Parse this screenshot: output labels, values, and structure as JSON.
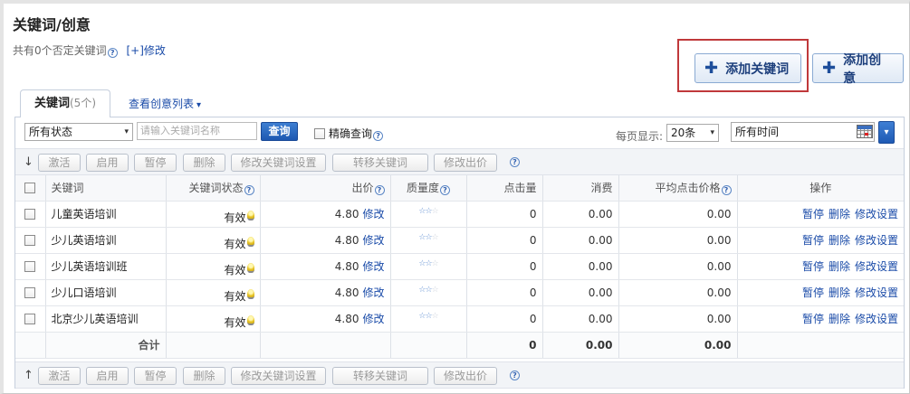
{
  "page": {
    "title": "关键词/创意",
    "negative_text": "共有0个否定关键词",
    "modify_link": "[+]修改"
  },
  "buttons": {
    "add_keyword": "添加关键词",
    "add_creative": "添加创意",
    "plus": "✚"
  },
  "tabs": {
    "active_label": "关键词",
    "active_count": "(5个)",
    "creative_link": "查看创意列表",
    "creative_arrow": "▾"
  },
  "filters": {
    "status_value": "所有状态",
    "search_placeholder": "请输入关键词名称",
    "search_button": "查询",
    "exact_label": "精确查询",
    "per_page_label": "每页显示:",
    "per_page_value": "20条",
    "time_value": "所有时间",
    "caret": "▾"
  },
  "actions": {
    "sort_top": "↓",
    "sort_bottom": "↑",
    "labels": [
      "激活",
      "启用",
      "暂停",
      "删除",
      "修改关键词设置",
      "转移关键词",
      "修改出价"
    ]
  },
  "table": {
    "headers": {
      "keyword": "关键词",
      "status": "关键词状态",
      "bid": "出价",
      "quality": "质量度",
      "clicks": "点击量",
      "spend": "消费",
      "avg_cpc": "平均点击价格",
      "ops": "操作"
    },
    "rows": [
      {
        "keyword": "儿童英语培训",
        "status": "有效",
        "bid": "4.80",
        "edit": "修改",
        "stars": 2,
        "clicks": "0",
        "spend": "0.00",
        "avg_cpc": "0.00"
      },
      {
        "keyword": "少儿英语培训",
        "status": "有效",
        "bid": "4.80",
        "edit": "修改",
        "stars": 2,
        "clicks": "0",
        "spend": "0.00",
        "avg_cpc": "0.00"
      },
      {
        "keyword": "少儿英语培训班",
        "status": "有效",
        "bid": "4.80",
        "edit": "修改",
        "stars": 2,
        "clicks": "0",
        "spend": "0.00",
        "avg_cpc": "0.00"
      },
      {
        "keyword": "少儿口语培训",
        "status": "有效",
        "bid": "4.80",
        "edit": "修改",
        "stars": 2,
        "clicks": "0",
        "spend": "0.00",
        "avg_cpc": "0.00"
      },
      {
        "keyword": "北京少儿英语培训",
        "status": "有效",
        "bid": "4.80",
        "edit": "修改",
        "stars": 2,
        "clicks": "0",
        "spend": "0.00",
        "avg_cpc": "0.00"
      }
    ],
    "row_ops": [
      "暂停",
      "删除",
      "修改设置"
    ],
    "total": {
      "label": "合计",
      "clicks": "0",
      "spend": "0.00",
      "avg_cpc": "0.00"
    }
  },
  "colors": {
    "link": "#1a4ba8",
    "highlight_border": "#c0393b",
    "primary_button": "#1d58b1"
  }
}
